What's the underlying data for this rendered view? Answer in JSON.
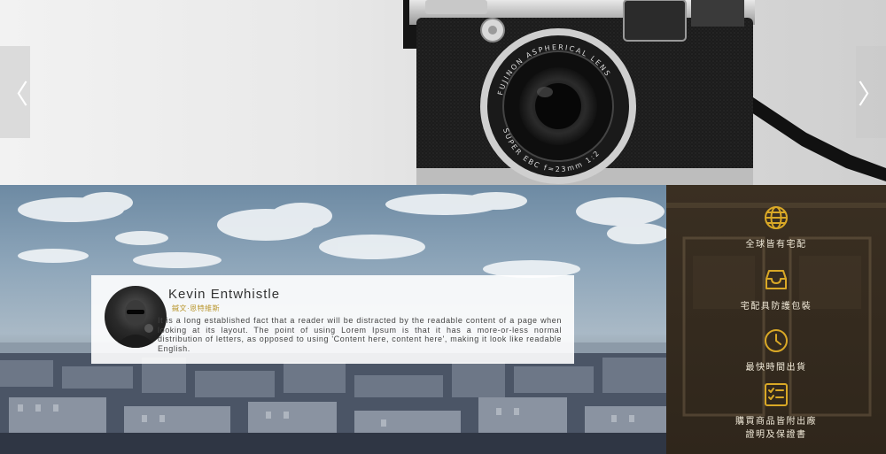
{
  "slider": {
    "prev_arrow": "〈",
    "next_arrow": "〉",
    "lens_text": "FUJINON ASPHERICAL LENS",
    "lens_text_bottom": "SUPER EBC f=23mm 1:2"
  },
  "testimonial": {
    "name": "Kevin Entwhistle",
    "subtitle": "鍼文·恩特維斯",
    "body": "It is a long established fact that a reader will be distracted by the readable content of a page when looking at its layout. The point of using Lorem Ipsum is that it has a more-or-less normal distribution of letters, as opposed to using 'Content here, content here', making it look like readable English."
  },
  "features": [
    {
      "icon": "globe-icon",
      "label": "全球皆有宅配"
    },
    {
      "icon": "tray-icon",
      "label": "宅配具防護包裝"
    },
    {
      "icon": "clock-icon",
      "label": "最快時間出貨"
    },
    {
      "icon": "checklist-icon",
      "label": "購買商品皆附出廠\n證明及保證書"
    }
  ],
  "colors": {
    "accent": "#d9a826",
    "subtitle_gold": "#b8952b",
    "panel_brown": "#34291e"
  }
}
